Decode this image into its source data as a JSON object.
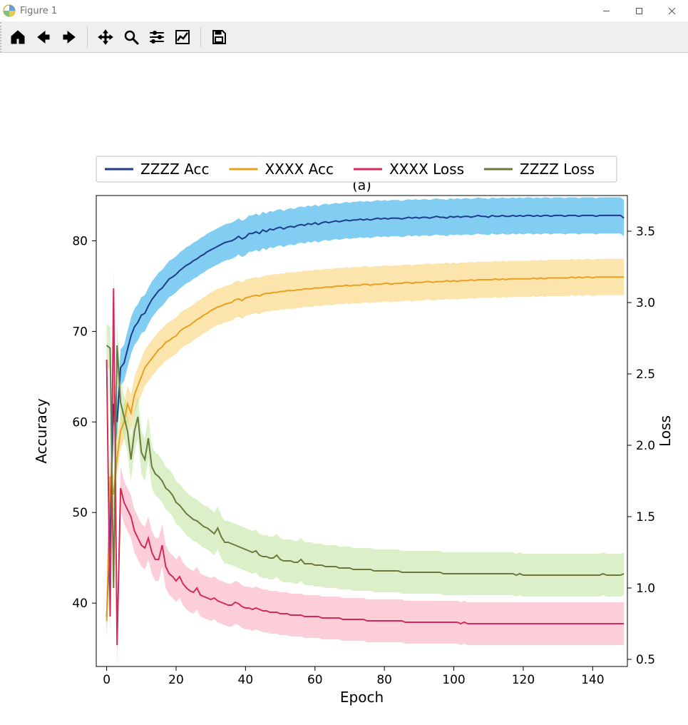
{
  "window": {
    "title": "Figure 1",
    "controls": {
      "minimize": "minimize",
      "maximize": "maximize",
      "close": "close"
    }
  },
  "toolbar": {
    "home": {
      "name": "home-icon"
    },
    "back": {
      "name": "back-icon"
    },
    "forward": {
      "name": "forward-icon"
    },
    "pan": {
      "name": "pan-icon"
    },
    "zoom": {
      "name": "zoom-icon"
    },
    "config": {
      "name": "configure-subplots-icon"
    },
    "axes": {
      "name": "edit-axes-icon"
    },
    "save": {
      "name": "save-icon"
    }
  },
  "chart": {
    "title": "(a)",
    "xlabel": "Epoch",
    "ylabel_left": "Accuracy",
    "ylabel_right": "Loss",
    "legend": {
      "zzzz_acc": "ZZZZ Acc",
      "xxxx_acc": "XXXX Acc",
      "xxxx_loss": "XXXX Loss",
      "zzzz_loss": "ZZZZ Loss"
    },
    "x_ticks": [
      "0",
      "20",
      "40",
      "60",
      "80",
      "100",
      "120",
      "140"
    ],
    "yL_ticks": [
      "40",
      "50",
      "60",
      "70",
      "80"
    ],
    "yR_ticks": [
      "0.5",
      "1.0",
      "1.5",
      "2.0",
      "2.5",
      "3.0",
      "3.5"
    ],
    "colors": {
      "zzzz_acc": "#1f3b8a",
      "zzzz_acc_band": "#1aa6e8",
      "xxxx_acc": "#e8a01d",
      "xxxx_acc_band": "#f8cf69",
      "xxxx_loss": "#d6295a",
      "xxxx_loss_band": "#f7a6bb",
      "zzzz_loss": "#6b7a3b",
      "zzzz_loss_band": "#bde39a"
    }
  },
  "chart_data": {
    "type": "line",
    "title": "(a)",
    "xlabel": "Epoch",
    "y_left_label": "Accuracy",
    "y_right_label": "Loss",
    "xlim": [
      -3,
      150
    ],
    "y_left_lim": [
      33,
      85
    ],
    "y_right_lim": [
      0.45,
      3.75
    ],
    "x": [
      0,
      1,
      2,
      3,
      4,
      5,
      6,
      7,
      8,
      9,
      10,
      11,
      12,
      13,
      14,
      15,
      16,
      17,
      18,
      19,
      20,
      21,
      22,
      23,
      24,
      25,
      26,
      27,
      28,
      29,
      30,
      31,
      32,
      33,
      34,
      35,
      36,
      37,
      38,
      39,
      40,
      41,
      42,
      43,
      44,
      45,
      46,
      47,
      48,
      49,
      50,
      51,
      52,
      53,
      54,
      55,
      56,
      57,
      58,
      59,
      60,
      61,
      62,
      63,
      64,
      65,
      66,
      67,
      68,
      69,
      70,
      71,
      72,
      73,
      74,
      75,
      76,
      77,
      78,
      79,
      80,
      81,
      82,
      83,
      84,
      85,
      86,
      87,
      88,
      89,
      90,
      91,
      92,
      93,
      94,
      95,
      96,
      97,
      98,
      99,
      100,
      101,
      102,
      103,
      104,
      105,
      106,
      107,
      108,
      109,
      110,
      111,
      112,
      113,
      114,
      115,
      116,
      117,
      118,
      119,
      120,
      121,
      122,
      123,
      124,
      125,
      126,
      127,
      128,
      129,
      130,
      131,
      132,
      133,
      134,
      135,
      136,
      137,
      138,
      139,
      140,
      141,
      142,
      143,
      144,
      145,
      146,
      147,
      148,
      149
    ],
    "series": [
      {
        "name": "ZZZZ Acc",
        "axis": "left",
        "color": "#1f3b8a",
        "band_color": "#1aa6e8",
        "band_width": 2.0,
        "values": [
          38.5,
          48.0,
          62.0,
          60.0,
          66.0,
          66.5,
          68.0,
          69.5,
          70.5,
          71.0,
          71.8,
          72.0,
          72.8,
          73.5,
          74.0,
          74.5,
          74.8,
          75.3,
          75.8,
          76.0,
          76.3,
          76.7,
          77.0,
          77.3,
          77.5,
          77.8,
          78.0,
          78.3,
          78.5,
          78.8,
          79.0,
          79.2,
          79.4,
          79.6,
          79.8,
          79.9,
          80.0,
          80.2,
          80.5,
          80.2,
          80.4,
          80.8,
          80.8,
          81.0,
          80.8,
          81.2,
          81.0,
          81.3,
          81.2,
          81.4,
          81.5,
          81.3,
          81.5,
          81.6,
          81.5,
          81.7,
          81.8,
          81.7,
          81.9,
          81.8,
          82.0,
          81.8,
          82.0,
          82.1,
          82.0,
          82.1,
          82.2,
          82.1,
          82.2,
          82.3,
          82.2,
          82.3,
          82.3,
          82.4,
          82.3,
          82.4,
          82.3,
          82.4,
          82.5,
          82.4,
          82.5,
          82.4,
          82.5,
          82.5,
          82.5,
          82.4,
          82.5,
          82.6,
          82.5,
          82.6,
          82.5,
          82.6,
          82.6,
          82.5,
          82.6,
          82.7,
          82.6,
          82.6,
          82.5,
          82.7,
          82.6,
          82.7,
          82.6,
          82.7,
          82.7,
          82.6,
          82.7,
          82.8,
          82.7,
          82.7,
          82.6,
          82.8,
          82.7,
          82.7,
          82.8,
          82.7,
          82.7,
          82.8,
          82.7,
          82.8,
          82.7,
          82.8,
          82.8,
          82.7,
          82.8,
          82.7,
          82.8,
          82.8,
          82.7,
          82.8,
          82.8,
          82.8,
          82.7,
          82.8,
          82.8,
          82.8,
          82.7,
          82.8,
          82.8,
          82.8,
          82.8,
          82.7,
          82.8,
          82.8,
          82.8,
          82.8,
          82.8,
          82.8,
          82.8,
          82.5
        ]
      },
      {
        "name": "XXXX Acc",
        "axis": "left",
        "color": "#e8a01d",
        "band_color": "#f8cf69",
        "band_width": 2.0,
        "values": [
          38.0,
          54.0,
          52.0,
          56.0,
          59.0,
          60.0,
          62.0,
          61.0,
          63.0,
          64.0,
          65.0,
          66.0,
          66.5,
          67.0,
          67.5,
          68.0,
          68.3,
          68.8,
          69.0,
          69.3,
          69.5,
          70.0,
          70.3,
          70.5,
          70.7,
          71.0,
          71.3,
          71.5,
          71.8,
          72.0,
          72.3,
          72.5,
          72.7,
          72.8,
          73.0,
          73.1,
          73.2,
          73.5,
          73.6,
          73.4,
          73.7,
          73.8,
          73.9,
          74.0,
          73.9,
          74.1,
          74.2,
          74.2,
          74.3,
          74.3,
          74.4,
          74.4,
          74.5,
          74.5,
          74.5,
          74.6,
          74.6,
          74.7,
          74.7,
          74.7,
          74.8,
          74.8,
          74.8,
          74.9,
          74.9,
          74.9,
          75.0,
          75.0,
          75.0,
          75.1,
          75.0,
          75.1,
          75.1,
          75.1,
          75.2,
          75.2,
          75.1,
          75.2,
          75.2,
          75.2,
          75.3,
          75.3,
          75.2,
          75.3,
          75.3,
          75.3,
          75.4,
          75.4,
          75.3,
          75.4,
          75.4,
          75.4,
          75.5,
          75.5,
          75.4,
          75.5,
          75.5,
          75.5,
          75.6,
          75.5,
          75.6,
          75.5,
          75.6,
          75.6,
          75.6,
          75.7,
          75.6,
          75.7,
          75.7,
          75.7,
          75.7,
          75.7,
          75.8,
          75.7,
          75.8,
          75.7,
          75.8,
          75.8,
          75.8,
          75.8,
          75.8,
          75.8,
          75.8,
          75.9,
          75.8,
          75.9,
          75.8,
          75.9,
          75.9,
          75.9,
          75.9,
          75.9,
          75.9,
          75.9,
          76.0,
          75.9,
          76.0,
          75.9,
          76.0,
          76.0,
          75.9,
          76.0,
          76.0,
          76.0,
          76.0,
          76.0,
          76.0,
          76.0,
          76.0,
          76.0
        ]
      },
      {
        "name": "XXXX Loss",
        "axis": "right",
        "color": "#d6295a",
        "band_color": "#f7a6bb",
        "band_width": 0.15,
        "values": [
          2.6,
          0.8,
          3.1,
          0.6,
          1.7,
          1.6,
          1.55,
          1.5,
          1.4,
          1.35,
          1.3,
          1.28,
          1.35,
          1.25,
          1.2,
          1.2,
          1.3,
          1.15,
          1.1,
          1.08,
          1.05,
          1.08,
          1.03,
          1.0,
          0.98,
          0.97,
          1.0,
          0.95,
          0.94,
          0.93,
          0.92,
          0.93,
          0.91,
          0.9,
          0.89,
          0.88,
          0.88,
          0.9,
          0.89,
          0.87,
          0.86,
          0.86,
          0.85,
          0.86,
          0.85,
          0.84,
          0.84,
          0.83,
          0.83,
          0.83,
          0.82,
          0.82,
          0.82,
          0.81,
          0.81,
          0.81,
          0.81,
          0.8,
          0.8,
          0.8,
          0.8,
          0.8,
          0.79,
          0.79,
          0.79,
          0.79,
          0.79,
          0.79,
          0.78,
          0.78,
          0.78,
          0.78,
          0.78,
          0.78,
          0.78,
          0.77,
          0.77,
          0.77,
          0.77,
          0.77,
          0.77,
          0.77,
          0.77,
          0.77,
          0.77,
          0.77,
          0.76,
          0.76,
          0.76,
          0.76,
          0.76,
          0.76,
          0.76,
          0.76,
          0.76,
          0.76,
          0.76,
          0.76,
          0.76,
          0.76,
          0.76,
          0.76,
          0.75,
          0.76,
          0.75,
          0.75,
          0.75,
          0.75,
          0.75,
          0.75,
          0.75,
          0.75,
          0.75,
          0.75,
          0.75,
          0.75,
          0.75,
          0.75,
          0.75,
          0.75,
          0.75,
          0.75,
          0.75,
          0.75,
          0.75,
          0.75,
          0.75,
          0.75,
          0.75,
          0.75,
          0.75,
          0.75,
          0.75,
          0.75,
          0.75,
          0.75,
          0.75,
          0.75,
          0.75,
          0.75,
          0.75,
          0.75,
          0.75,
          0.75,
          0.75,
          0.75,
          0.75,
          0.75,
          0.75,
          0.75
        ]
      },
      {
        "name": "ZZZZ Loss",
        "axis": "right",
        "color": "#6b7a3b",
        "band_color": "#bde39a",
        "band_width": 0.15,
        "values": [
          2.7,
          2.68,
          1.0,
          2.7,
          2.3,
          2.2,
          2.1,
          1.9,
          2.1,
          2.2,
          1.95,
          1.9,
          2.05,
          1.85,
          1.8,
          1.78,
          1.75,
          1.7,
          1.68,
          1.65,
          1.6,
          1.58,
          1.55,
          1.52,
          1.5,
          1.48,
          1.47,
          1.45,
          1.43,
          1.42,
          1.4,
          1.38,
          1.42,
          1.36,
          1.32,
          1.32,
          1.31,
          1.3,
          1.29,
          1.28,
          1.27,
          1.26,
          1.25,
          1.26,
          1.23,
          1.22,
          1.22,
          1.21,
          1.21,
          1.23,
          1.2,
          1.19,
          1.19,
          1.19,
          1.18,
          1.18,
          1.2,
          1.17,
          1.17,
          1.17,
          1.16,
          1.16,
          1.16,
          1.15,
          1.15,
          1.15,
          1.15,
          1.14,
          1.14,
          1.14,
          1.14,
          1.13,
          1.13,
          1.13,
          1.13,
          1.13,
          1.13,
          1.12,
          1.12,
          1.12,
          1.12,
          1.12,
          1.12,
          1.12,
          1.12,
          1.11,
          1.11,
          1.11,
          1.11,
          1.11,
          1.11,
          1.11,
          1.11,
          1.11,
          1.11,
          1.11,
          1.11,
          1.1,
          1.1,
          1.1,
          1.1,
          1.1,
          1.1,
          1.1,
          1.1,
          1.1,
          1.1,
          1.1,
          1.1,
          1.1,
          1.1,
          1.1,
          1.1,
          1.1,
          1.1,
          1.1,
          1.1,
          1.1,
          1.09,
          1.1,
          1.09,
          1.09,
          1.09,
          1.09,
          1.09,
          1.09,
          1.09,
          1.09,
          1.09,
          1.09,
          1.09,
          1.09,
          1.09,
          1.09,
          1.09,
          1.09,
          1.09,
          1.09,
          1.09,
          1.09,
          1.09,
          1.09,
          1.09,
          1.1,
          1.09,
          1.09,
          1.09,
          1.09,
          1.09,
          1.1
        ]
      }
    ],
    "legend_position": "top"
  }
}
